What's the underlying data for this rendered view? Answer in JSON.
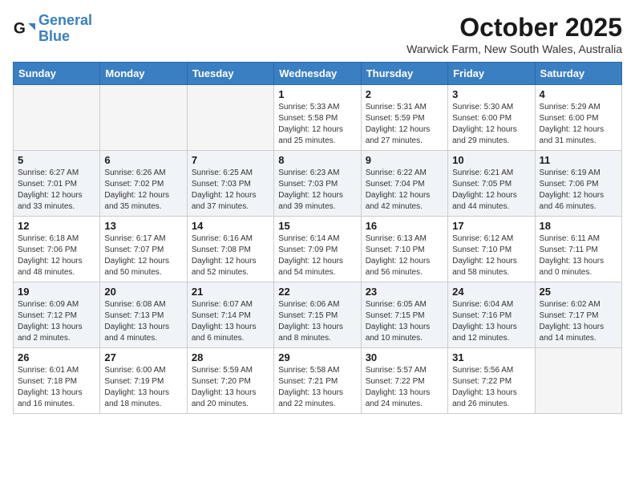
{
  "header": {
    "logo_line1": "General",
    "logo_line2": "Blue",
    "month": "October 2025",
    "location": "Warwick Farm, New South Wales, Australia"
  },
  "weekdays": [
    "Sunday",
    "Monday",
    "Tuesday",
    "Wednesday",
    "Thursday",
    "Friday",
    "Saturday"
  ],
  "weeks": [
    [
      {
        "day": "",
        "info": ""
      },
      {
        "day": "",
        "info": ""
      },
      {
        "day": "",
        "info": ""
      },
      {
        "day": "1",
        "info": "Sunrise: 5:33 AM\nSunset: 5:58 PM\nDaylight: 12 hours\nand 25 minutes."
      },
      {
        "day": "2",
        "info": "Sunrise: 5:31 AM\nSunset: 5:59 PM\nDaylight: 12 hours\nand 27 minutes."
      },
      {
        "day": "3",
        "info": "Sunrise: 5:30 AM\nSunset: 6:00 PM\nDaylight: 12 hours\nand 29 minutes."
      },
      {
        "day": "4",
        "info": "Sunrise: 5:29 AM\nSunset: 6:00 PM\nDaylight: 12 hours\nand 31 minutes."
      }
    ],
    [
      {
        "day": "5",
        "info": "Sunrise: 6:27 AM\nSunset: 7:01 PM\nDaylight: 12 hours\nand 33 minutes."
      },
      {
        "day": "6",
        "info": "Sunrise: 6:26 AM\nSunset: 7:02 PM\nDaylight: 12 hours\nand 35 minutes."
      },
      {
        "day": "7",
        "info": "Sunrise: 6:25 AM\nSunset: 7:03 PM\nDaylight: 12 hours\nand 37 minutes."
      },
      {
        "day": "8",
        "info": "Sunrise: 6:23 AM\nSunset: 7:03 PM\nDaylight: 12 hours\nand 39 minutes."
      },
      {
        "day": "9",
        "info": "Sunrise: 6:22 AM\nSunset: 7:04 PM\nDaylight: 12 hours\nand 42 minutes."
      },
      {
        "day": "10",
        "info": "Sunrise: 6:21 AM\nSunset: 7:05 PM\nDaylight: 12 hours\nand 44 minutes."
      },
      {
        "day": "11",
        "info": "Sunrise: 6:19 AM\nSunset: 7:06 PM\nDaylight: 12 hours\nand 46 minutes."
      }
    ],
    [
      {
        "day": "12",
        "info": "Sunrise: 6:18 AM\nSunset: 7:06 PM\nDaylight: 12 hours\nand 48 minutes."
      },
      {
        "day": "13",
        "info": "Sunrise: 6:17 AM\nSunset: 7:07 PM\nDaylight: 12 hours\nand 50 minutes."
      },
      {
        "day": "14",
        "info": "Sunrise: 6:16 AM\nSunset: 7:08 PM\nDaylight: 12 hours\nand 52 minutes."
      },
      {
        "day": "15",
        "info": "Sunrise: 6:14 AM\nSunset: 7:09 PM\nDaylight: 12 hours\nand 54 minutes."
      },
      {
        "day": "16",
        "info": "Sunrise: 6:13 AM\nSunset: 7:10 PM\nDaylight: 12 hours\nand 56 minutes."
      },
      {
        "day": "17",
        "info": "Sunrise: 6:12 AM\nSunset: 7:10 PM\nDaylight: 12 hours\nand 58 minutes."
      },
      {
        "day": "18",
        "info": "Sunrise: 6:11 AM\nSunset: 7:11 PM\nDaylight: 13 hours\nand 0 minutes."
      }
    ],
    [
      {
        "day": "19",
        "info": "Sunrise: 6:09 AM\nSunset: 7:12 PM\nDaylight: 13 hours\nand 2 minutes."
      },
      {
        "day": "20",
        "info": "Sunrise: 6:08 AM\nSunset: 7:13 PM\nDaylight: 13 hours\nand 4 minutes."
      },
      {
        "day": "21",
        "info": "Sunrise: 6:07 AM\nSunset: 7:14 PM\nDaylight: 13 hours\nand 6 minutes."
      },
      {
        "day": "22",
        "info": "Sunrise: 6:06 AM\nSunset: 7:15 PM\nDaylight: 13 hours\nand 8 minutes."
      },
      {
        "day": "23",
        "info": "Sunrise: 6:05 AM\nSunset: 7:15 PM\nDaylight: 13 hours\nand 10 minutes."
      },
      {
        "day": "24",
        "info": "Sunrise: 6:04 AM\nSunset: 7:16 PM\nDaylight: 13 hours\nand 12 minutes."
      },
      {
        "day": "25",
        "info": "Sunrise: 6:02 AM\nSunset: 7:17 PM\nDaylight: 13 hours\nand 14 minutes."
      }
    ],
    [
      {
        "day": "26",
        "info": "Sunrise: 6:01 AM\nSunset: 7:18 PM\nDaylight: 13 hours\nand 16 minutes."
      },
      {
        "day": "27",
        "info": "Sunrise: 6:00 AM\nSunset: 7:19 PM\nDaylight: 13 hours\nand 18 minutes."
      },
      {
        "day": "28",
        "info": "Sunrise: 5:59 AM\nSunset: 7:20 PM\nDaylight: 13 hours\nand 20 minutes."
      },
      {
        "day": "29",
        "info": "Sunrise: 5:58 AM\nSunset: 7:21 PM\nDaylight: 13 hours\nand 22 minutes."
      },
      {
        "day": "30",
        "info": "Sunrise: 5:57 AM\nSunset: 7:22 PM\nDaylight: 13 hours\nand 24 minutes."
      },
      {
        "day": "31",
        "info": "Sunrise: 5:56 AM\nSunset: 7:22 PM\nDaylight: 13 hours\nand 26 minutes."
      },
      {
        "day": "",
        "info": ""
      }
    ]
  ]
}
